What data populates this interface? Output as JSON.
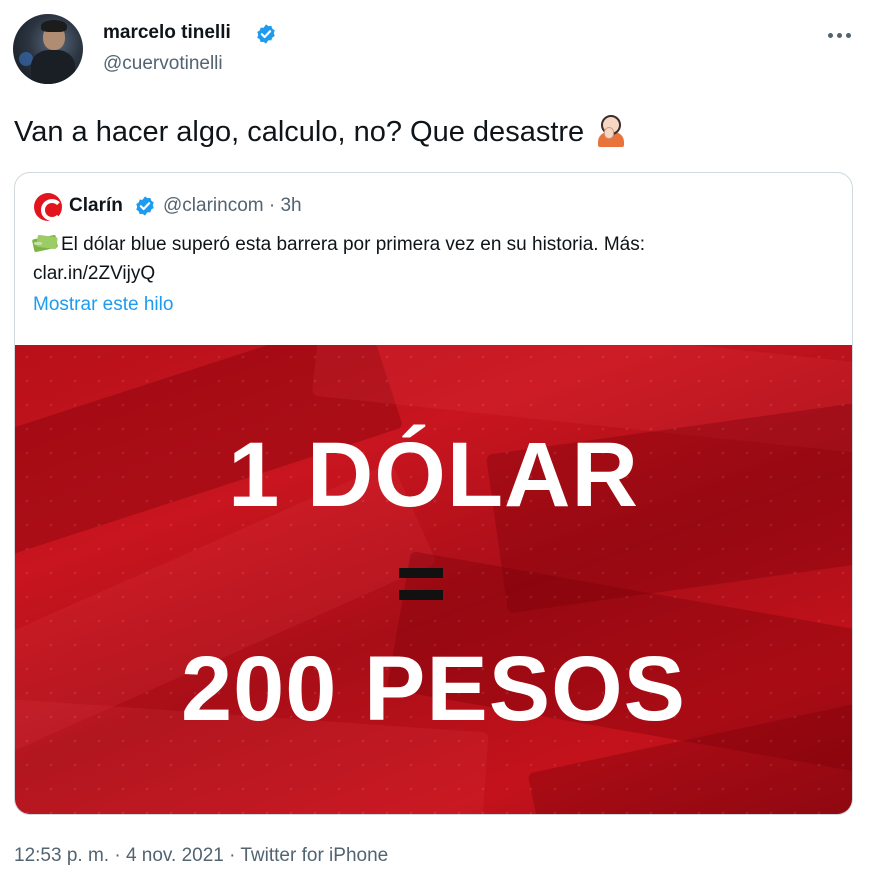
{
  "author": {
    "name": "marcelo tinelli",
    "handle": "@cuervotinelli"
  },
  "tweet": {
    "text": "Van a hacer algo, calculo, no? Que desastre",
    "emoji": "person-facepalming-icon"
  },
  "quoted": {
    "name": "Clarín",
    "meta": "@clarincom · 3h",
    "text": "El dólar blue superó esta barrera por primera vez en su historia. Más:",
    "link": "clar.in/2ZVijyQ",
    "show_thread": "Mostrar este hilo",
    "image": {
      "line1": "1 DÓLAR",
      "line2": "200 PESOS"
    }
  },
  "footer": {
    "timestamp": "12:53 p. m. · 4 nov. 2021 · Twitter for iPhone"
  },
  "colors": {
    "verified": "#1d9bf0",
    "link": "#1d9bf0",
    "image_red": "#c8151f",
    "muted": "#536471"
  }
}
